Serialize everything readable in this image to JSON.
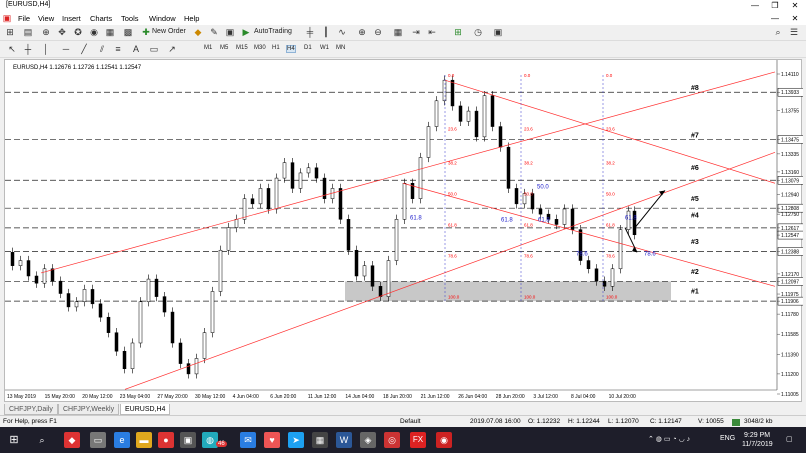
{
  "window": {
    "title": "[EURUSD,H4]",
    "min": "—",
    "max": "❐",
    "close": "✕"
  },
  "menu": [
    "File",
    "View",
    "Insert",
    "Charts",
    "Tools",
    "Window",
    "Help"
  ],
  "toolbar": {
    "new_order": "New Order",
    "autotrading": "AutoTrading",
    "timeframes": [
      "M1",
      "M5",
      "M15",
      "M30",
      "H1",
      "H4",
      "D1",
      "W1",
      "MN"
    ],
    "active_timeframe": "H4"
  },
  "chart": {
    "header": "EURUSD,H4  1.12676 1.12726 1.12541 1.12547",
    "price_labels": [
      "1.14110",
      "1.13933",
      "1.13755",
      "1.13475",
      "1.13335",
      "1.13160",
      "1.13079",
      "1.12940",
      "1.12808",
      "1.12750",
      "1.12617",
      "1.12547",
      "1.12388",
      "1.12170",
      "1.12097",
      "1.11975",
      "1.11906",
      "1.11780",
      "1.11585",
      "1.11390",
      "1.11200",
      "1.11005"
    ],
    "highlighted_prices": [
      "1.13933",
      "1.13475",
      "1.13079",
      "1.12808",
      "1.12617",
      "1.12547",
      "1.12388",
      "1.12097",
      "1.11906"
    ],
    "time_labels": [
      "13 May 2019",
      "15 May 20:00",
      "20 May 12:00",
      "23 May 04:00",
      "27 May 20:00",
      "30 May 12:00",
      "4 Jun 04:00",
      "6 Jun 20:00",
      "11 Jun 12:00",
      "14 Jun 04:00",
      "18 Jun 20:00",
      "21 Jun 12:00",
      "26 Jun 04:00",
      "28 Jun 20:00",
      "3 Jul 12:00",
      "8 Jul 04:00",
      "10 Jul 20:00"
    ],
    "levels": [
      "#8",
      "#7",
      "#6",
      "#5",
      "#4",
      "#3",
      "#2",
      "#1"
    ],
    "fib_red": [
      "0.0",
      "23.6",
      "38.2",
      "50.0",
      "61.8",
      "78.6",
      "100.0"
    ],
    "fib_blue": [
      "61.8",
      "61.8",
      "50.0",
      "61.8",
      "78.6",
      "78.6",
      "61.8"
    ],
    "colors": {
      "trend": "#ff3030",
      "fib_vline": "#3333cc",
      "fib_text": "#ff0000",
      "fib_blue_text": "#2222cc",
      "level_line": "#222222",
      "zone": "#c8c8c8",
      "price_highlight": "#000000"
    }
  },
  "tabs": [
    "CHFJPY,Daily",
    "CHFJPY,Weekly",
    "EURUSD,H4"
  ],
  "active_tab": "EURUSD,H4",
  "status": {
    "help": "For Help, press F1",
    "profile": "Default",
    "datetime": "2019.07.08 16:00",
    "open": "O: 1.12232",
    "high": "H: 1.12244",
    "low": "L: 1.12070",
    "close": "C: 1.12147",
    "volume": "V: 10055",
    "traffic": "3048/2 kb"
  },
  "taskbar": {
    "time": "9:29 PM",
    "date": "11/7/2019",
    "lang": "ENG",
    "badge": "46"
  }
}
